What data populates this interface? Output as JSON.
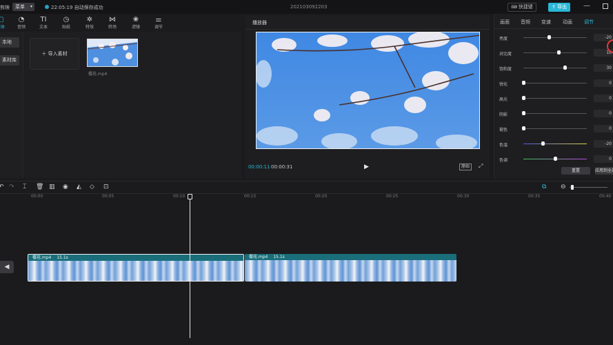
{
  "titlebar": {
    "app_label": "剪映",
    "menu_label": "菜单",
    "save_status": "22:05:19 自动保存成功",
    "project_name": "202103092203",
    "shortcut_label": "快捷键",
    "export_label": "导出"
  },
  "toolbar": {
    "items": [
      {
        "label": "媒体",
        "icon": "media-icon"
      },
      {
        "label": "音频",
        "icon": "audio-icon"
      },
      {
        "label": "文本",
        "icon": "text-icon"
      },
      {
        "label": "贴纸",
        "icon": "sticker-icon"
      },
      {
        "label": "特效",
        "icon": "effects-icon"
      },
      {
        "label": "转场",
        "icon": "transition-icon"
      },
      {
        "label": "滤镜",
        "icon": "filter-icon"
      },
      {
        "label": "调节",
        "icon": "adjust-icon"
      }
    ]
  },
  "leftnav": {
    "items": [
      {
        "label": "本地"
      },
      {
        "label": "素材库"
      }
    ]
  },
  "media": {
    "import_label": "导入素材",
    "file_name": "樱花.mp4"
  },
  "player": {
    "title": "播放器",
    "current_time": "00:00:11",
    "total_time": "00:00:31",
    "ratio_label": "原始"
  },
  "inspector": {
    "tabs": [
      {
        "label": "画面",
        "active": false
      },
      {
        "label": "音频",
        "active": false
      },
      {
        "label": "变速",
        "active": false
      },
      {
        "label": "动画",
        "active": false
      },
      {
        "label": "调节",
        "active": true
      }
    ],
    "rows": [
      {
        "label": "亮度",
        "value": "-20",
        "level": 0.4
      },
      {
        "label": "对比度",
        "value": "10",
        "level": 0.55
      },
      {
        "label": "饱和度",
        "value": "30",
        "level": 0.65
      },
      {
        "label": "锐化",
        "value": "0",
        "level": 0.0
      },
      {
        "label": "高光",
        "value": "0",
        "level": 0.0
      },
      {
        "label": "阴影",
        "value": "0",
        "level": 0.0
      },
      {
        "label": "褪色",
        "value": "0",
        "level": 0.0
      },
      {
        "label": "色温",
        "value": "-20",
        "level": 0.3
      },
      {
        "label": "色调",
        "value": "0",
        "level": 0.5
      }
    ],
    "reset_label": "重置",
    "apply_all_label": "应用到全部"
  },
  "timeline": {
    "ticks": [
      "00:00",
      "00:05",
      "00:10",
      "00:15",
      "00:20",
      "00:25",
      "00:30",
      "00:35",
      "00:40"
    ],
    "clips": [
      {
        "name": "樱花.mp4",
        "duration": "15.1s"
      },
      {
        "name": "樱花.mp4",
        "duration": "15.1s"
      }
    ]
  },
  "colors": {
    "accent": "#2bb7d6",
    "clip_header": "#1a6e7a",
    "highlight_circle": "#e23b3b"
  }
}
